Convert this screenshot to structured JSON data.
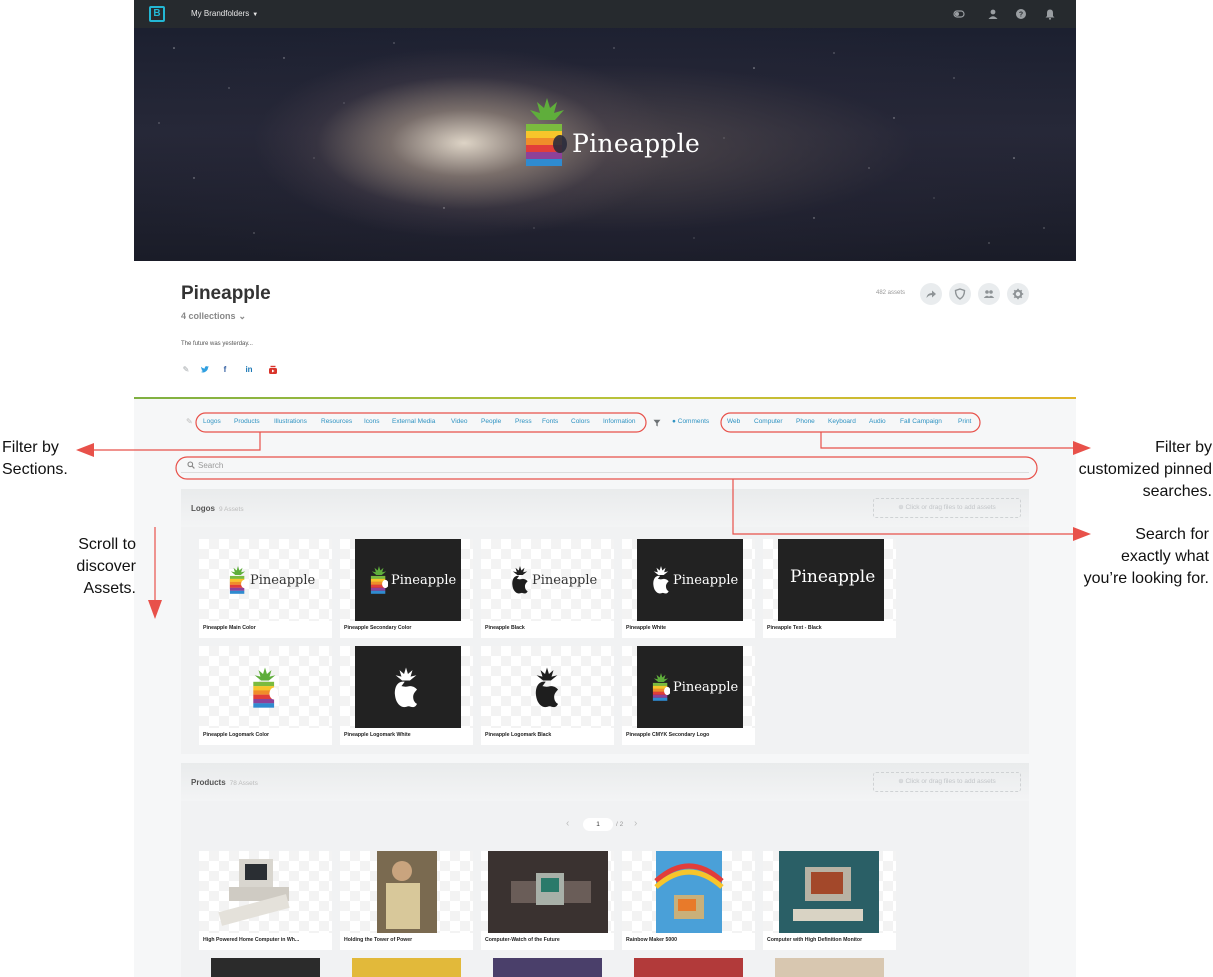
{
  "nav": {
    "brand_menu": "My Brandfolders",
    "logo_letter": "B",
    "icons": [
      "toggle-icon",
      "user-icon",
      "help-icon",
      "bell-icon"
    ]
  },
  "hero": {
    "brand_name": "Pineapple"
  },
  "brandfolder": {
    "title": "Pineapple",
    "collections": "4 collections",
    "tagline": "The future was yesterday...",
    "assets_count": "482 assets",
    "social_icons": [
      "edit-icon",
      "twitter-icon",
      "facebook-icon",
      "linkedin-icon",
      "youtube-icon"
    ]
  },
  "sections_nav": [
    "Logos",
    "Products",
    "Illustrations",
    "Resources",
    "Icons",
    "External Media",
    "Video",
    "People",
    "Press",
    "Fonts",
    "Colors",
    "Information"
  ],
  "comments_label": "Comments",
  "pinned_searches": [
    "Web",
    "Computer",
    "Phone",
    "Keyboard",
    "Audio",
    "Fall Campaign",
    "Print"
  ],
  "search": {
    "placeholder": "Search"
  },
  "sections": [
    {
      "title": "Logos",
      "count": "9 Assets",
      "dropzone": "Click or drag files to add assets",
      "assets": [
        "Pineapple Main Color",
        "Pineapple Secondary Color",
        "Pineapple Black",
        "Pineapple White",
        "Pineapple Text - Black",
        "Pineapple Logomark Color",
        "Pineapple Logomark White",
        "Pineapple Logomark Black",
        "Pineapple CMYK Secondary Logo"
      ]
    },
    {
      "title": "Products",
      "count": "78 Assets",
      "dropzone": "Click or drag files to add assets",
      "pager": {
        "current": "1",
        "total": "/ 2"
      },
      "assets": [
        "High Powered Home Computer in Wh...",
        "Holding the Tower of Power",
        "Computer-Watch of the Future",
        "Rainbow Maker 5000",
        "Computer with High Definition Monitor"
      ]
    }
  ],
  "annotations": {
    "filter_sections": [
      "Filter by",
      "Sections."
    ],
    "scroll": [
      "Scroll to",
      "discover",
      "Assets."
    ],
    "filter_pinned": [
      "Filter by",
      "customized pinned",
      "searches."
    ],
    "search_for": [
      "Search for",
      "exactly what",
      "you’re looking for."
    ]
  },
  "colors": {
    "annotation": "#e8514a",
    "link": "#2f93c2",
    "nav_bg": "#262a2e",
    "brand_accent": "#23b7d4"
  }
}
